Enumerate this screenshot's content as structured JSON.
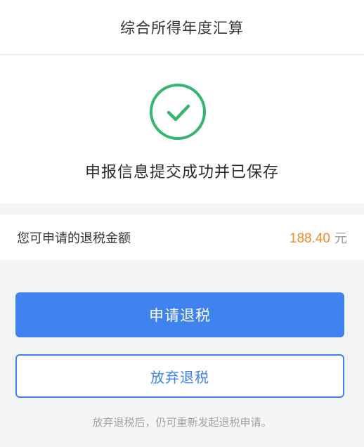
{
  "header": {
    "title": "综合所得年度汇算"
  },
  "result": {
    "icon": "check-circle-icon",
    "message": "申报信息提交成功并已保存",
    "color": "#35b56d"
  },
  "refund": {
    "label": "您可申请的退税金额",
    "amount": "188.40",
    "unit": "元",
    "amount_color": "#f08a2b"
  },
  "actions": {
    "apply_label": "申请退税",
    "waive_label": "放弃退税",
    "accent_color": "#3f84ee"
  },
  "footnote": "放弃退税后，仍可重新发起退税申请。"
}
